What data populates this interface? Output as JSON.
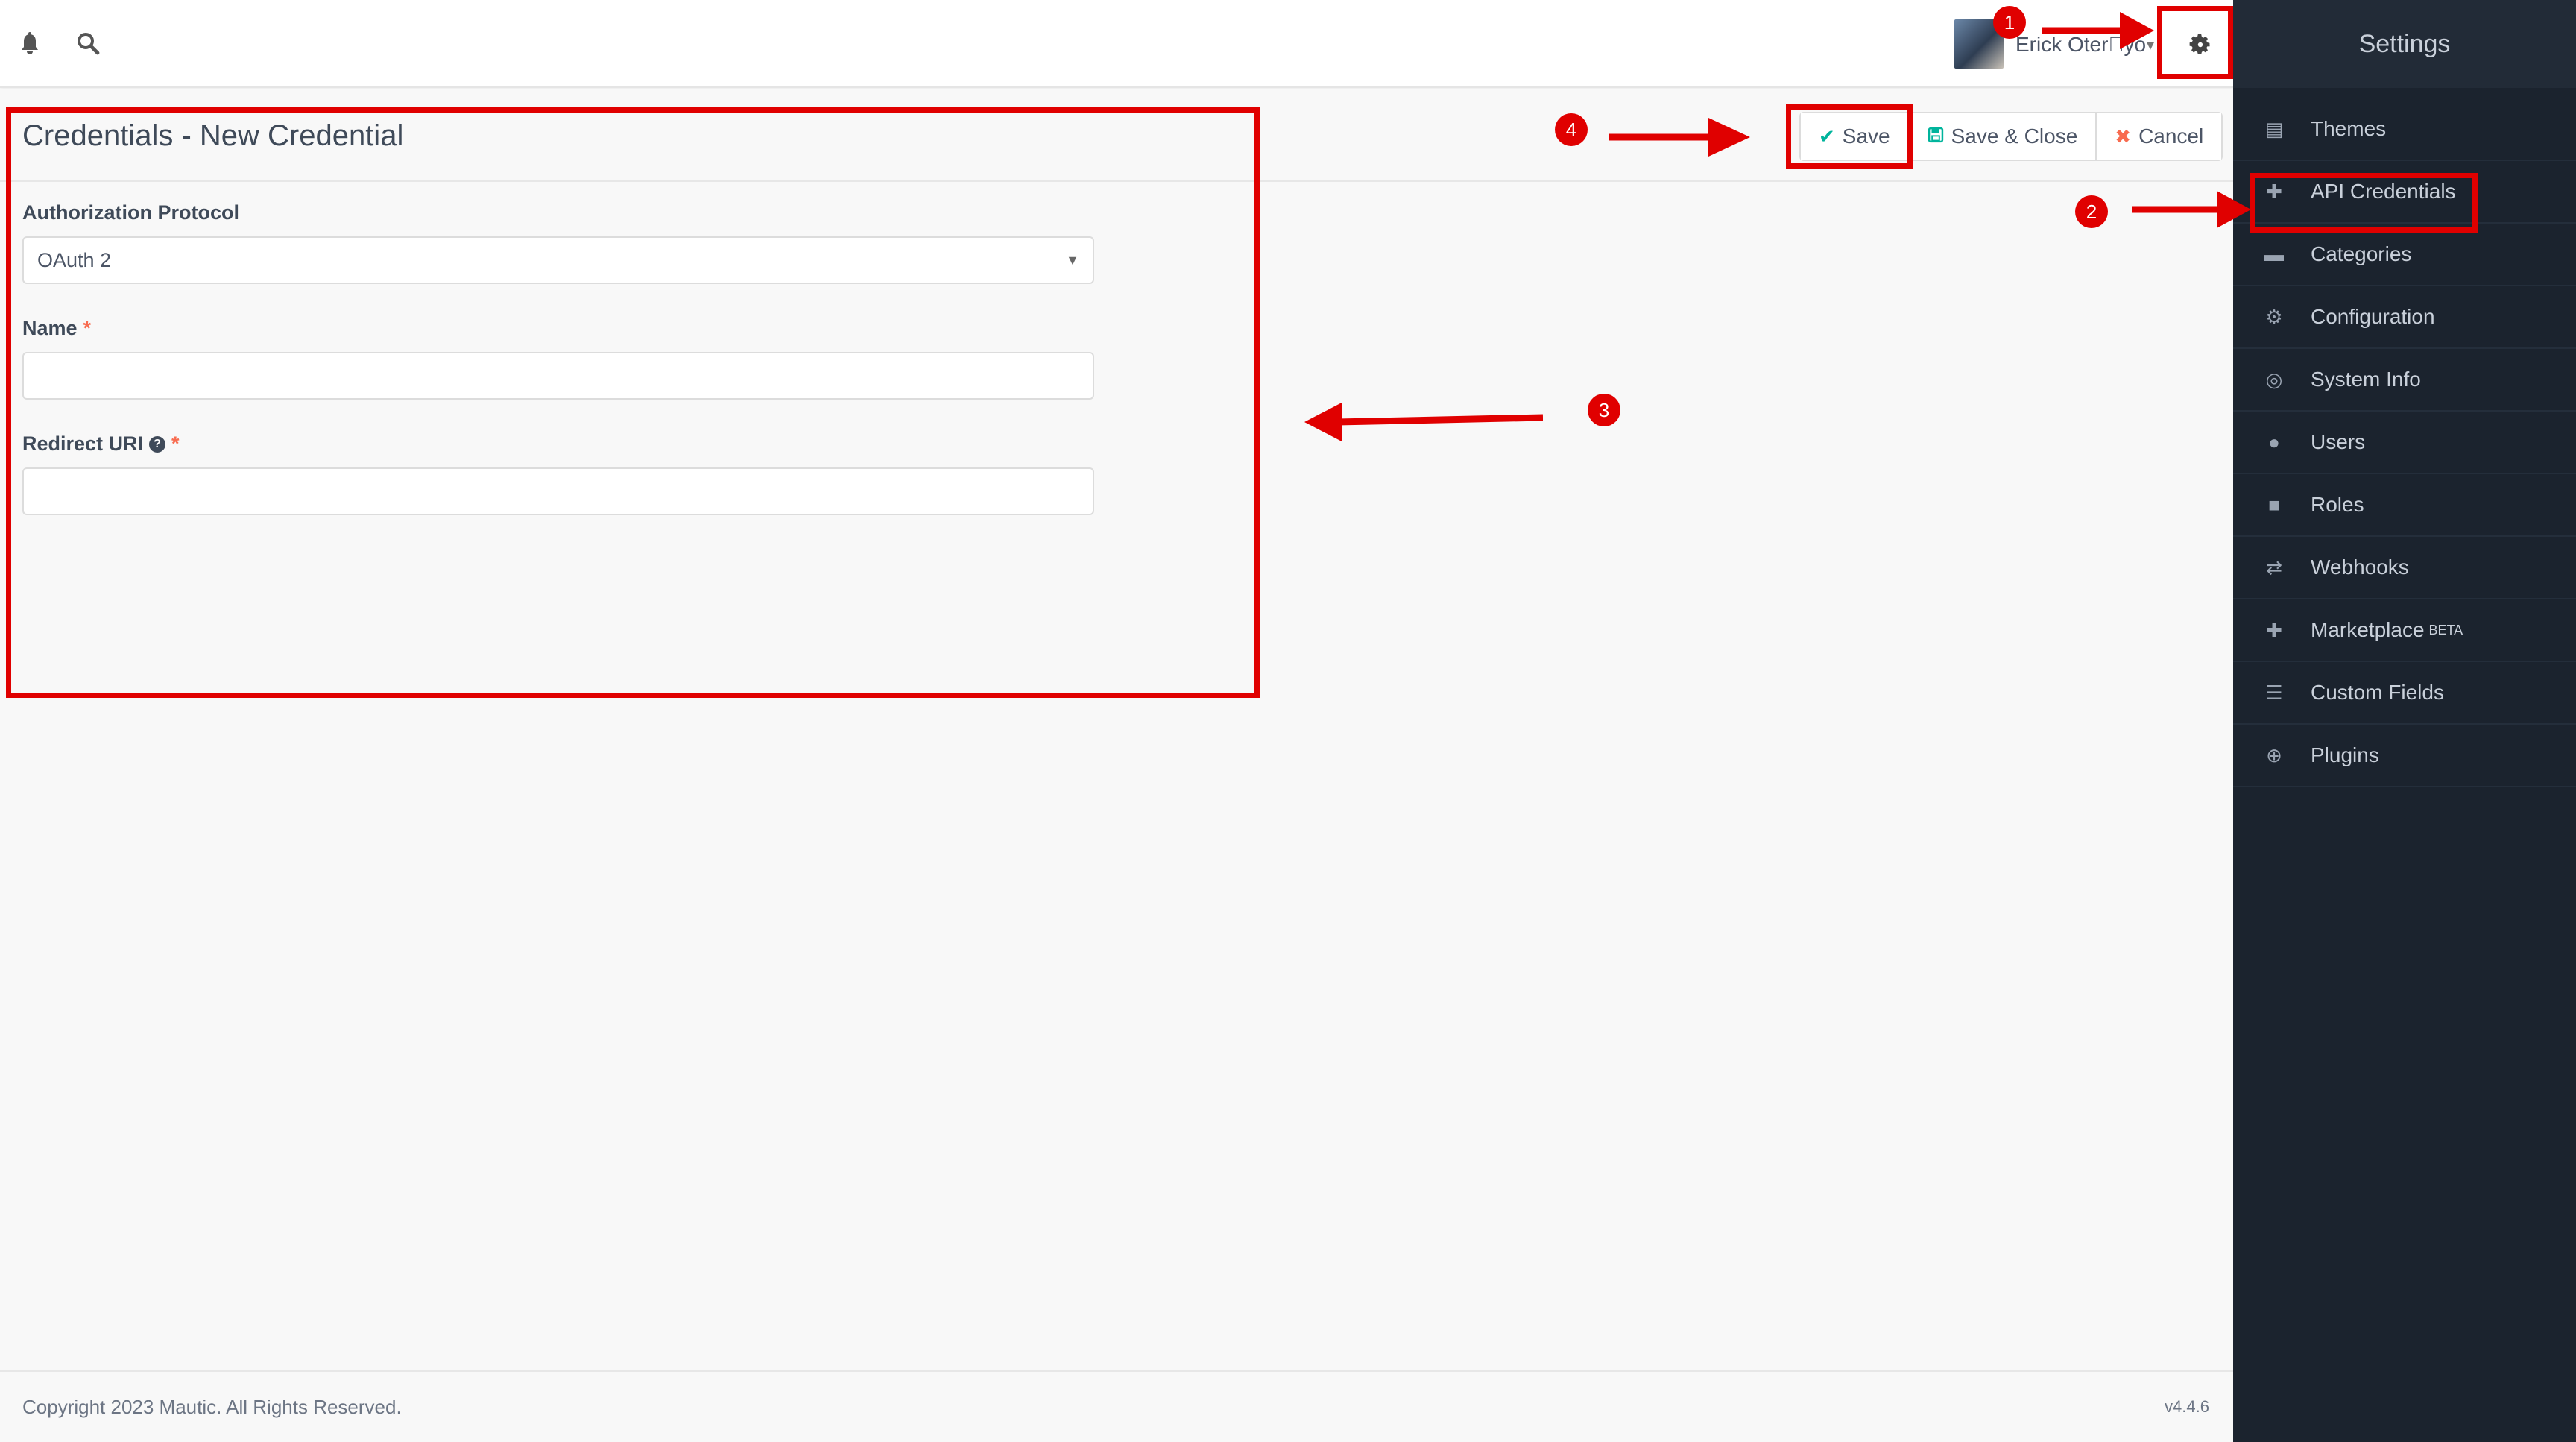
{
  "topbar": {
    "notifications_icon": "bell-icon",
    "search_icon": "search-icon",
    "user_name": "Erick Oter\u0000yo",
    "settings_icon": "gear-icon"
  },
  "page": {
    "title": "Credentials - New Credential"
  },
  "actions": {
    "save_label": "Save",
    "save_close_label": "Save & Close",
    "cancel_label": "Cancel"
  },
  "form": {
    "protocol_label": "Authorization Protocol",
    "protocol_value": "OAuth 2",
    "name_label": "Name",
    "name_value": "",
    "redirect_label": "Redirect URI",
    "redirect_value": "",
    "required_mark": "*",
    "help_mark": "?"
  },
  "sidebar": {
    "title": "Settings",
    "items": [
      {
        "label": "Themes",
        "icon": "themes-icon"
      },
      {
        "label": "API Credentials",
        "icon": "puzzle-icon"
      },
      {
        "label": "Categories",
        "icon": "folder-icon"
      },
      {
        "label": "Configuration",
        "icon": "cogs-icon"
      },
      {
        "label": "System Info",
        "icon": "life-ring-icon"
      },
      {
        "label": "Users",
        "icon": "users-icon"
      },
      {
        "label": "Roles",
        "icon": "lock-icon"
      },
      {
        "label": "Webhooks",
        "icon": "exchange-icon"
      },
      {
        "label": "Marketplace",
        "icon": "plus-icon",
        "badge": "BETA"
      },
      {
        "label": "Custom Fields",
        "icon": "list-icon"
      },
      {
        "label": "Plugins",
        "icon": "plus-circle-icon"
      }
    ]
  },
  "footer": {
    "copyright": "Copyright 2023 Mautic. All Rights Reserved.",
    "version": "v4.4.6"
  },
  "annotations": {
    "step1": "1",
    "step2": "2",
    "step3": "3",
    "step4": "4",
    "color": "#e00000"
  }
}
